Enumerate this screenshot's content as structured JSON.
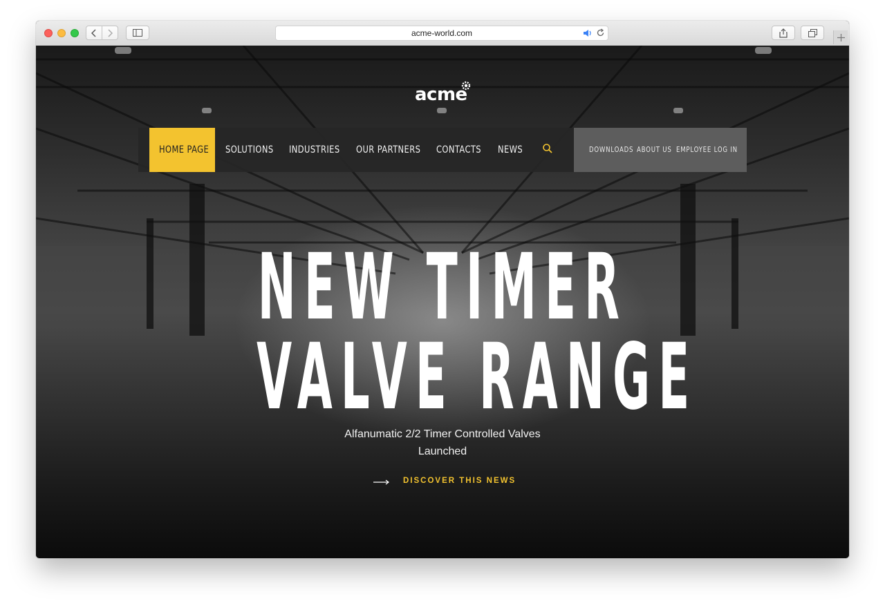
{
  "browser": {
    "url": "acme-world.com"
  },
  "site": {
    "logo": "acme"
  },
  "nav": {
    "items": [
      {
        "label": "HOME PAGE",
        "active": true
      },
      {
        "label": "SOLUTIONS"
      },
      {
        "label": "INDUSTRIES"
      },
      {
        "label": "OUR PARTNERS"
      },
      {
        "label": "CONTACTS"
      },
      {
        "label": "NEWS"
      }
    ],
    "secondary": [
      "DOWNLOADS",
      "ABOUT US",
      "EMPLOYEE LOG IN"
    ]
  },
  "hero": {
    "line1": "NEW TIMER",
    "line2": "VALVE RANGE",
    "subtitle_line1": "Alfanumatic 2/2 Timer Controlled Valves",
    "subtitle_line2": "Launched",
    "cta": "DISCOVER THIS NEWS"
  },
  "colors": {
    "accent": "#f3c32f",
    "nav_bg": "#262626",
    "secondary_bg": "#5d5d5d"
  },
  "icons": [
    "close-icon",
    "minimize-icon",
    "zoom-icon",
    "back-arrow-icon",
    "forward-arrow-icon",
    "sidebar-icon",
    "speaker-icon",
    "reload-icon",
    "share-icon",
    "tabs-icon",
    "plus-icon",
    "gear-icon",
    "search-icon",
    "arrow-right-icon"
  ]
}
